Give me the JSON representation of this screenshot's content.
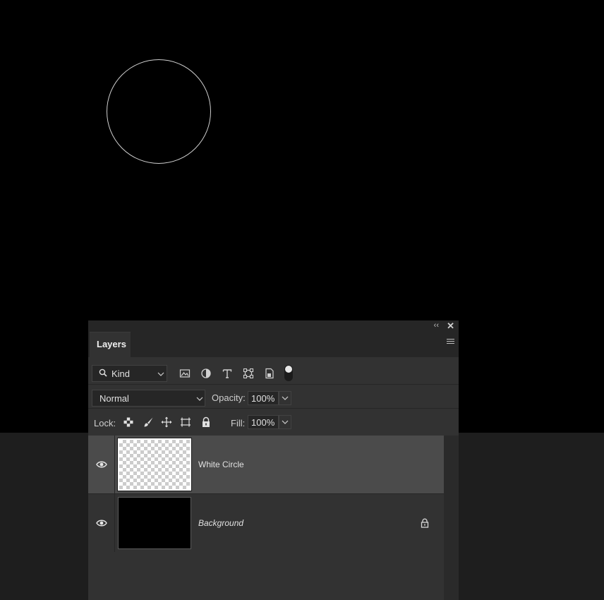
{
  "panel": {
    "collapse_icon": "double-chevron-left-icon",
    "close_icon": "close-icon",
    "tab_label": "Layers",
    "menu_icon": "panel-menu-icon"
  },
  "filter": {
    "kind_label": "Kind",
    "icons": [
      "image-filter-icon",
      "adjustment-filter-icon",
      "type-filter-icon",
      "shape-filter-icon",
      "smart-object-filter-icon"
    ],
    "toggle_on": true
  },
  "blend": {
    "mode": "Normal",
    "opacity_label": "Opacity:",
    "opacity_value": "100%"
  },
  "lock": {
    "label": "Lock:",
    "icons": [
      "lock-transparent-pixels-icon",
      "lock-image-pixels-icon",
      "lock-position-icon",
      "lock-artboard-icon",
      "lock-all-icon"
    ],
    "fill_label": "Fill:",
    "fill_value": "100%"
  },
  "layers": [
    {
      "name": "White Circle",
      "visible": true,
      "selected": true,
      "thumbnail": "transparent-checker",
      "locked": false
    },
    {
      "name": "Background",
      "visible": true,
      "selected": false,
      "thumbnail": "black",
      "locked": true
    }
  ],
  "colors": {
    "canvas": "#000000",
    "panel_bg": "#323232",
    "selected_row": "#4b4b4b",
    "circle_stroke": "#cfcfcf"
  }
}
